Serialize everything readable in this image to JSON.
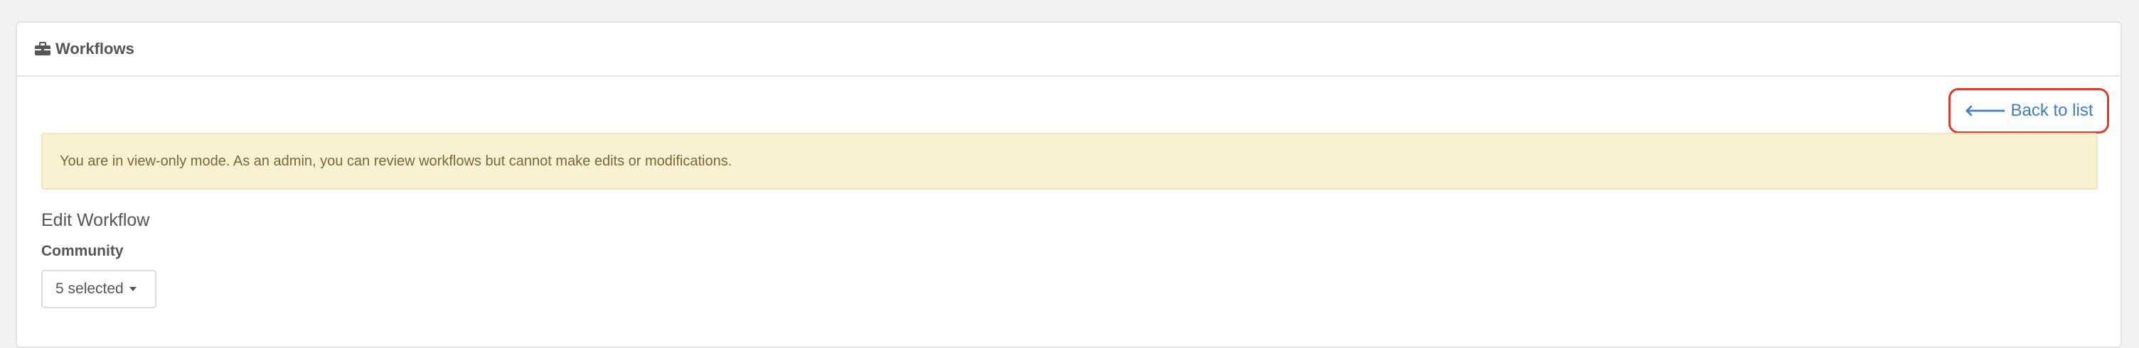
{
  "panel": {
    "title": "Workflows",
    "icon": "briefcase-icon"
  },
  "actions": {
    "back_label": "Back to list",
    "back_icon": "arrow-left-icon"
  },
  "alert": {
    "message": "You are in view-only mode. As an admin, you can review workflows but cannot make edits or modifications."
  },
  "form": {
    "title": "Edit Workflow",
    "community": {
      "label": "Community",
      "selected_value": "5 selected"
    }
  },
  "colors": {
    "link": "#3d7ebf",
    "highlight_border": "#e03a2e",
    "alert_bg": "#f9f2d2",
    "alert_text": "#7a6636"
  }
}
